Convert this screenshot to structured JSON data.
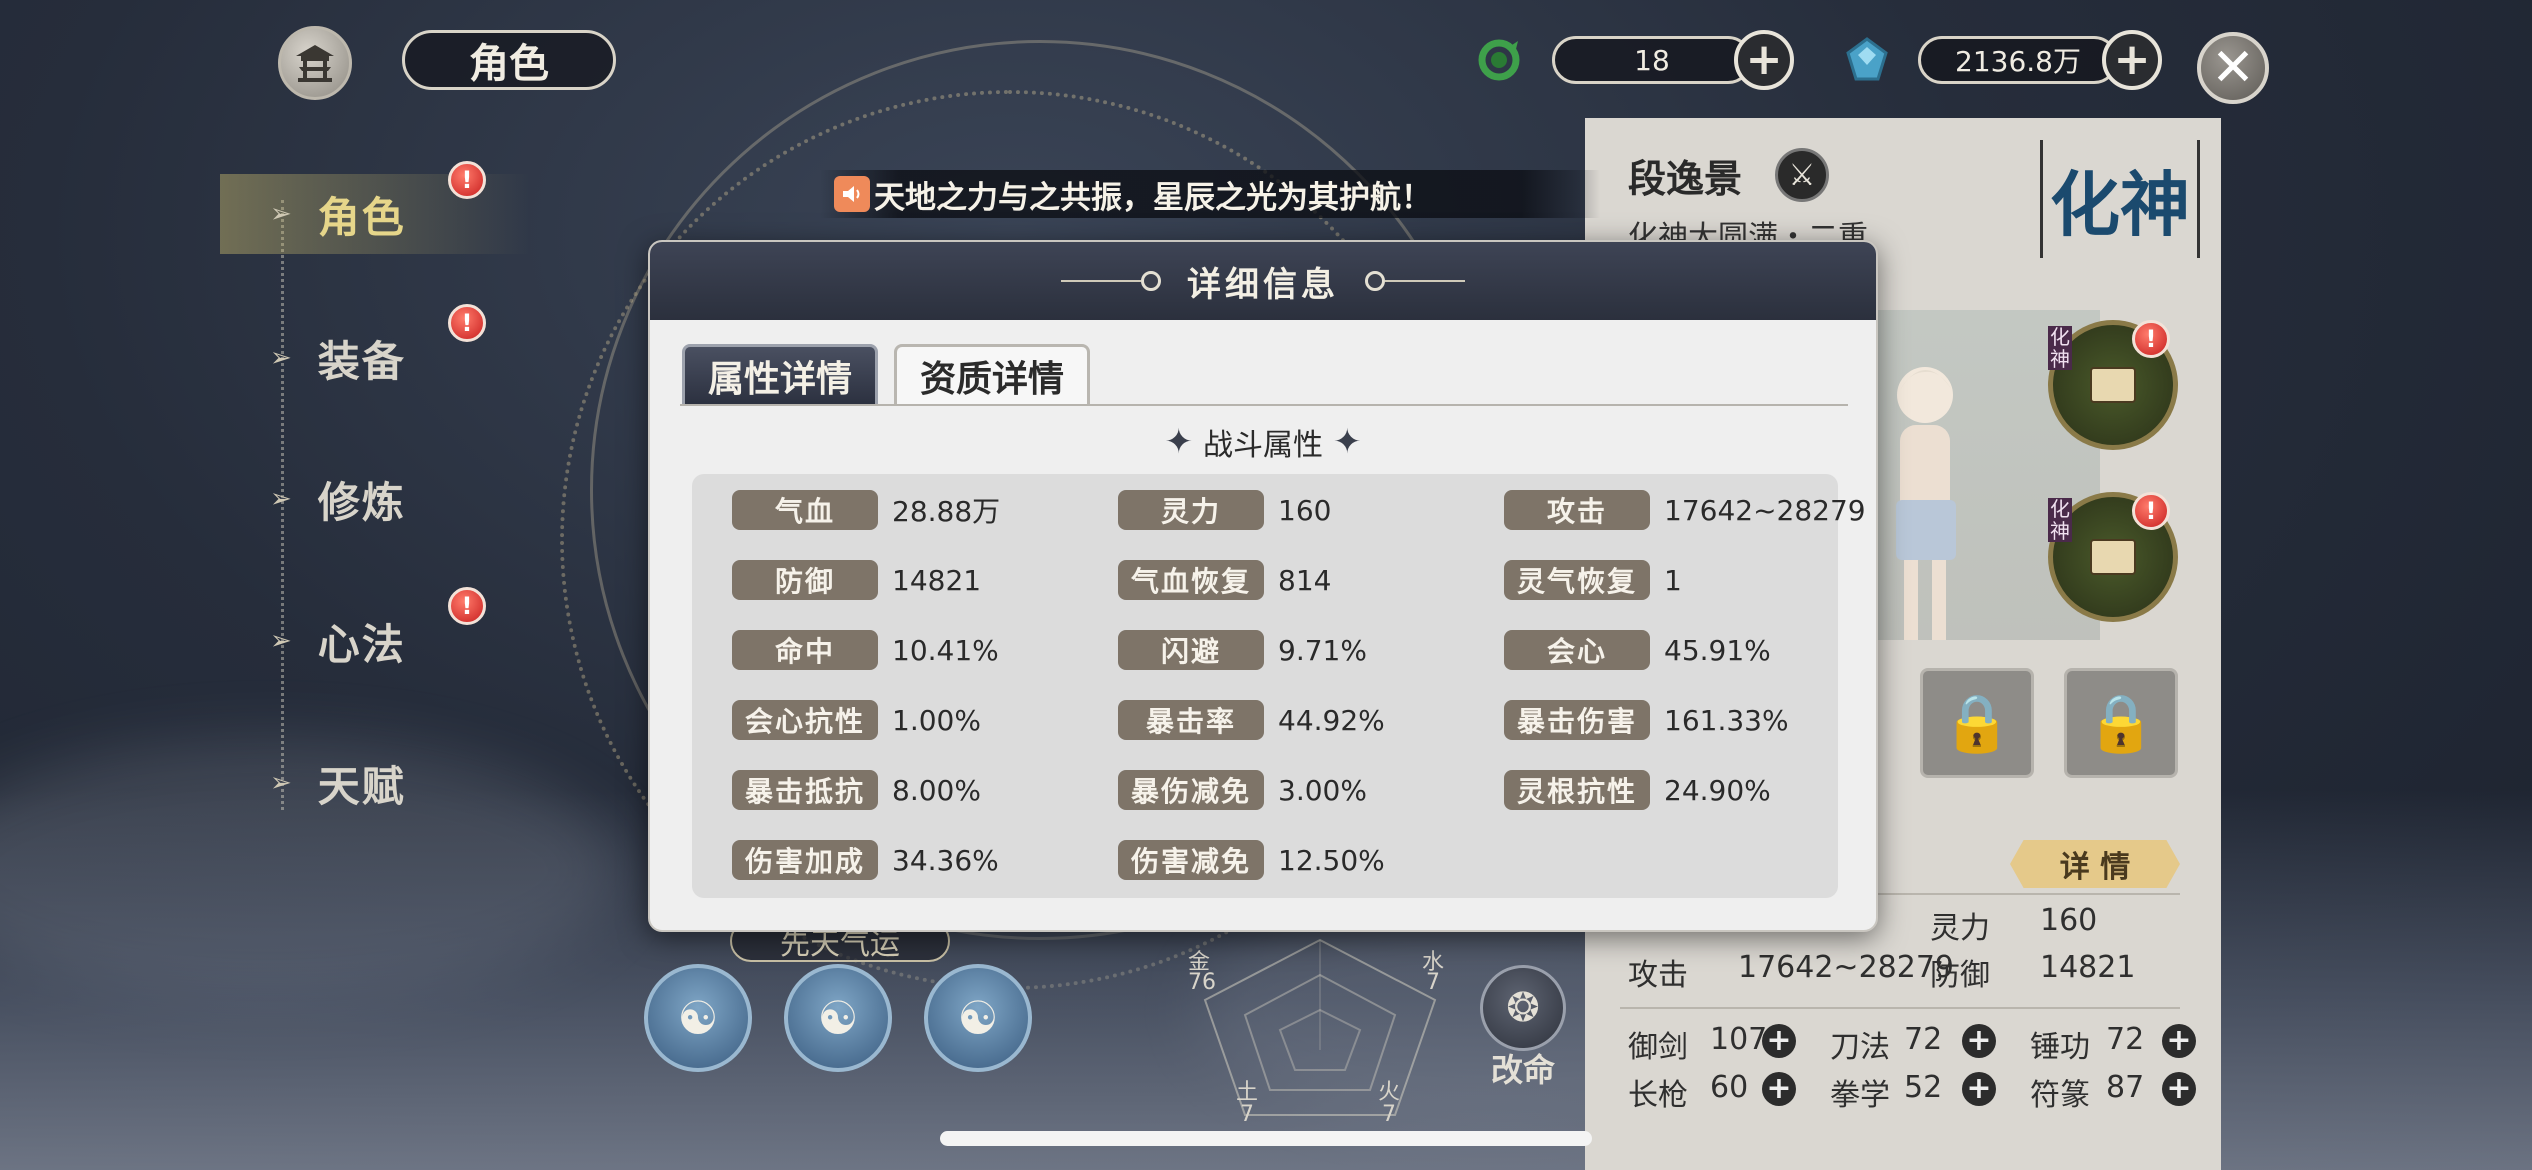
{
  "top_bar": {
    "title": "角色",
    "currency1_value": "18",
    "currency2_value": "2136.8万",
    "home_icon": "pavilion-icon",
    "currency1_icon": "jade-ring-icon",
    "currency2_icon": "spirit-stone-icon",
    "close_icon": "close-icon"
  },
  "sidebar": {
    "items": [
      {
        "label": "角色",
        "badge": "!",
        "active": true
      },
      {
        "label": "装备",
        "badge": "!"
      },
      {
        "label": "修炼"
      },
      {
        "label": "心法",
        "badge": "!"
      },
      {
        "label": "天赋"
      }
    ]
  },
  "broadcast": {
    "text": "天地之力与之共振，星辰之光为其护航！",
    "icon": "speaker-icon"
  },
  "character_panel": {
    "name": "段逸景",
    "realm": "化神大圆满・二重",
    "realm_seal": "化神",
    "detail_button": "详 情",
    "summary": {
      "lingli_label": "灵力",
      "lingli_value": "160",
      "attack_label": "攻击",
      "attack_value": "17642~28279",
      "defense_label": "防御",
      "defense_value": "14821"
    },
    "skills": [
      {
        "label": "御剑",
        "value": "107"
      },
      {
        "label": "刀法",
        "value": "72"
      },
      {
        "label": "锤功",
        "value": "72"
      },
      {
        "label": "长枪",
        "value": "60"
      },
      {
        "label": "拳学",
        "value": "52"
      },
      {
        "label": "符篆",
        "value": "87"
      }
    ],
    "slot_tag": "化神"
  },
  "background": {
    "fate_banner": "先天气运",
    "change_fate_label": "改命",
    "radar_labels": {
      "metal": "金",
      "metal_value": "76",
      "water": "水",
      "water_value": "7",
      "earth": "土",
      "earth_value": "7",
      "fire": "火",
      "fire_value": "7"
    }
  },
  "modal": {
    "title": "详细信息",
    "tabs": [
      {
        "label": "属性详情",
        "active": true
      },
      {
        "label": "资质详情",
        "active": false
      }
    ],
    "section_title": "战斗属性",
    "stats": [
      [
        {
          "label": "气血",
          "value": "28.88万"
        },
        {
          "label": "灵力",
          "value": "160"
        },
        {
          "label": "攻击",
          "value": "17642~28279"
        }
      ],
      [
        {
          "label": "防御",
          "value": "14821"
        },
        {
          "label": "气血恢复",
          "value": "814"
        },
        {
          "label": "灵气恢复",
          "value": "1"
        }
      ],
      [
        {
          "label": "命中",
          "value": "10.41%"
        },
        {
          "label": "闪避",
          "value": "9.71%"
        },
        {
          "label": "会心",
          "value": "45.91%"
        }
      ],
      [
        {
          "label": "会心抗性",
          "value": "1.00%"
        },
        {
          "label": "暴击率",
          "value": "44.92%"
        },
        {
          "label": "暴击伤害",
          "value": "161.33%"
        }
      ],
      [
        {
          "label": "暴击抵抗",
          "value": "8.00%"
        },
        {
          "label": "暴伤减免",
          "value": "3.00%"
        },
        {
          "label": "灵根抗性",
          "value": "24.90%"
        }
      ],
      [
        {
          "label": "伤害加成",
          "value": "34.36%"
        },
        {
          "label": "伤害减免",
          "value": "12.50%"
        }
      ]
    ]
  },
  "colors": {
    "stat_label_bg": "#7e7468",
    "header_bg": "#2b303d",
    "badge_red": "#c81f1f",
    "detail_gold": "#e5c98a"
  }
}
